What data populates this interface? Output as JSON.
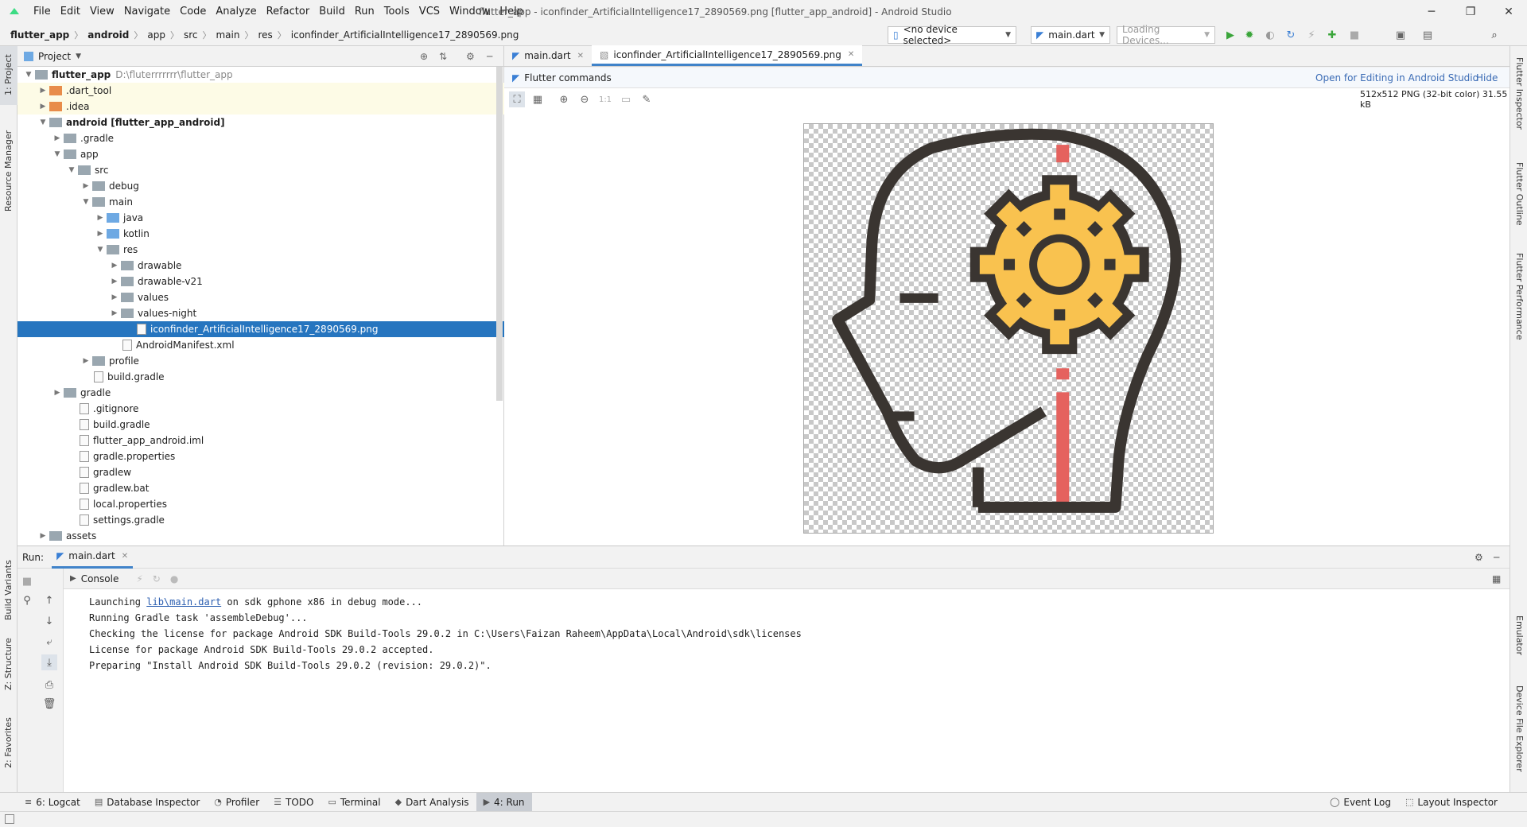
{
  "window": {
    "title": "flutter_app - iconfinder_ArtificialIntelligence17_2890569.png [flutter_app_android] - Android Studio"
  },
  "menu": [
    "File",
    "Edit",
    "View",
    "Navigate",
    "Code",
    "Analyze",
    "Refactor",
    "Build",
    "Run",
    "Tools",
    "VCS",
    "Window",
    "Help"
  ],
  "breadcrumb": [
    "flutter_app",
    "android",
    "app",
    "src",
    "main",
    "res",
    "iconfinder_ArtificialIntelligence17_2890569.png"
  ],
  "toolbar": {
    "device_select": "<no device selected>",
    "run_config": "main.dart",
    "loading_devices": "Loading Devices..."
  },
  "left_strip": {
    "project": "1: Project",
    "resource_manager": "Resource Manager",
    "build_variants": "Build Variants",
    "structure": "Z: Structure",
    "favorites": "2: Favorites"
  },
  "right_strip": {
    "flutter_inspector": "Flutter Inspector",
    "flutter_outline": "Flutter Outline",
    "flutter_performance": "Flutter Performance",
    "emulator": "Emulator",
    "device_file_explorer": "Device File Explorer"
  },
  "project_panel": {
    "title": "Project",
    "root_path": "D:\\fluterrrrrrr\\flutter_app",
    "tree": [
      {
        "label": "flutter_app",
        "depth": 0,
        "kind": "folder-gray",
        "open": true,
        "bold": true
      },
      {
        "label": ".dart_tool",
        "depth": 1,
        "kind": "folder-orange",
        "open": false
      },
      {
        "label": ".idea",
        "depth": 1,
        "kind": "folder-orange",
        "open": false
      },
      {
        "label": "android [flutter_app_android]",
        "depth": 1,
        "kind": "folder-gray",
        "open": true,
        "bold": true
      },
      {
        "label": ".gradle",
        "depth": 2,
        "kind": "folder-gray",
        "open": false
      },
      {
        "label": "app",
        "depth": 2,
        "kind": "folder-gray",
        "open": true
      },
      {
        "label": "src",
        "depth": 3,
        "kind": "folder-gray",
        "open": true
      },
      {
        "label": "debug",
        "depth": 4,
        "kind": "folder-gray",
        "open": false
      },
      {
        "label": "main",
        "depth": 4,
        "kind": "folder-gray",
        "open": true
      },
      {
        "label": "java",
        "depth": 5,
        "kind": "folder-blue",
        "open": false
      },
      {
        "label": "kotlin",
        "depth": 5,
        "kind": "folder-blue",
        "open": false
      },
      {
        "label": "res",
        "depth": 5,
        "kind": "folder-gray",
        "open": true
      },
      {
        "label": "drawable",
        "depth": 6,
        "kind": "folder-gray",
        "open": false
      },
      {
        "label": "drawable-v21",
        "depth": 6,
        "kind": "folder-gray",
        "open": false
      },
      {
        "label": "values",
        "depth": 6,
        "kind": "folder-gray",
        "open": false
      },
      {
        "label": "values-night",
        "depth": 6,
        "kind": "folder-gray",
        "open": false
      },
      {
        "label": "iconfinder_ArtificialIntelligence17_2890569.png",
        "depth": 7,
        "kind": "file",
        "selected": true
      },
      {
        "label": "AndroidManifest.xml",
        "depth": 6,
        "kind": "file"
      },
      {
        "label": "profile",
        "depth": 4,
        "kind": "folder-gray",
        "open": false
      },
      {
        "label": "build.gradle",
        "depth": 4,
        "kind": "file"
      },
      {
        "label": "gradle",
        "depth": 2,
        "kind": "folder-gray",
        "open": false
      },
      {
        "label": ".gitignore",
        "depth": 3,
        "kind": "file"
      },
      {
        "label": "build.gradle",
        "depth": 3,
        "kind": "file"
      },
      {
        "label": "flutter_app_android.iml",
        "depth": 3,
        "kind": "file"
      },
      {
        "label": "gradle.properties",
        "depth": 3,
        "kind": "file"
      },
      {
        "label": "gradlew",
        "depth": 3,
        "kind": "file"
      },
      {
        "label": "gradlew.bat",
        "depth": 3,
        "kind": "file"
      },
      {
        "label": "local.properties",
        "depth": 3,
        "kind": "file"
      },
      {
        "label": "settings.gradle",
        "depth": 3,
        "kind": "file"
      },
      {
        "label": "assets",
        "depth": 1,
        "kind": "folder-gray",
        "open": false
      }
    ]
  },
  "editor": {
    "tabs": [
      {
        "label": "main.dart",
        "active": false
      },
      {
        "label": "iconfinder_ArtificialIntelligence17_2890569.png",
        "active": true
      }
    ],
    "flutter_commands": "Flutter commands",
    "open_for_editing": "Open for Editing in Android Studio",
    "hide": "Hide",
    "image_info": "512x512 PNG (32-bit color) 31.55 kB",
    "zoom_actual": "1:1"
  },
  "run_panel": {
    "label": "Run:",
    "tab": "main.dart",
    "console_tab": "Console",
    "lines": [
      {
        "prefix": "Launching ",
        "link": "lib\\main.dart",
        "suffix": " on sdk gphone x86 in debug mode..."
      },
      {
        "prefix": "Running Gradle task 'assembleDebug'...",
        "link": "",
        "suffix": ""
      },
      {
        "prefix": "Checking the license for package Android SDK Build-Tools 29.0.2 in C:\\Users\\Faizan Raheem\\AppData\\Local\\Android\\sdk\\licenses",
        "link": "",
        "suffix": ""
      },
      {
        "prefix": "License for package Android SDK Build-Tools 29.0.2 accepted.",
        "link": "",
        "suffix": ""
      },
      {
        "prefix": "Preparing \"Install Android SDK Build-Tools 29.0.2 (revision: 29.0.2)\".",
        "link": "",
        "suffix": ""
      }
    ]
  },
  "bottom_bar": {
    "left": [
      {
        "label": "6: Logcat",
        "icon": "≡",
        "active": false
      },
      {
        "label": "Database Inspector",
        "icon": "▤",
        "active": false
      },
      {
        "label": "Profiler",
        "icon": "◔",
        "active": false
      },
      {
        "label": "TODO",
        "icon": "☰",
        "active": false
      },
      {
        "label": "Terminal",
        "icon": "▭",
        "active": false
      },
      {
        "label": "Dart Analysis",
        "icon": "◆",
        "active": false
      },
      {
        "label": "4: Run",
        "icon": "▶",
        "active": true
      }
    ],
    "right": [
      {
        "label": "Event Log",
        "icon": "◯"
      },
      {
        "label": "Layout Inspector",
        "icon": "⬚"
      }
    ]
  },
  "colors": {
    "selection": "#2675bf",
    "gear": "#f9c24f",
    "outline": "#3a3531",
    "red": "#e5625e"
  }
}
